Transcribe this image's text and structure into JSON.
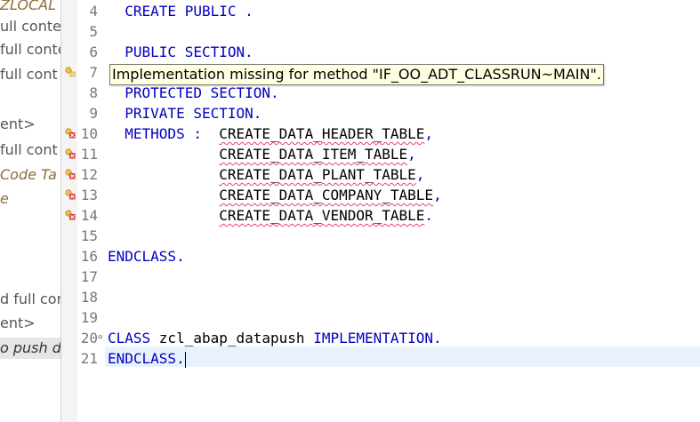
{
  "outline": {
    "items": [
      {
        "text": "ZLOCAL",
        "style": "italic"
      },
      {
        "text": "ull conten",
        "style": "normal"
      },
      {
        "text": "full conte",
        "style": "normal"
      },
      {
        "text": "full cont",
        "style": "normal"
      },
      {
        "text": "ent>",
        "style": "normal"
      },
      {
        "text": "full cont",
        "style": "normal"
      },
      {
        "text": "Code Ta",
        "style": "italic"
      },
      {
        "text": "e",
        "style": "italic"
      },
      {
        "text": "d full con",
        "style": "normal"
      },
      {
        "text": "ent>",
        "style": "normal"
      },
      {
        "text": "o push d",
        "style": "selected"
      }
    ]
  },
  "editor": {
    "lines": [
      {
        "num": "4",
        "tokens": [
          {
            "t": "  CREATE PUBLIC .",
            "c": "kw"
          }
        ]
      },
      {
        "num": "5",
        "tokens": []
      },
      {
        "num": "6",
        "tokens": [
          {
            "t": "  PUBLIC SECTION.",
            "c": "kw"
          }
        ]
      },
      {
        "num": "7",
        "tokens": [],
        "marker": "warning"
      },
      {
        "num": "8",
        "tokens": [
          {
            "t": "  PROTECTED SECTION.",
            "c": "kw"
          }
        ]
      },
      {
        "num": "9",
        "tokens": [
          {
            "t": "  PRIVATE SECTION.",
            "c": "kw"
          }
        ]
      },
      {
        "num": "10",
        "marker": "error",
        "tokens": [
          {
            "t": "  METHODS :  ",
            "c": "kw"
          },
          {
            "t": "CREATE_DATA_HEADER_TABLE",
            "c": "err"
          },
          {
            "t": ",",
            "c": "kw"
          }
        ]
      },
      {
        "num": "11",
        "marker": "error",
        "tokens": [
          {
            "t": "             ",
            "c": "id"
          },
          {
            "t": "CREATE_DATA_ITEM_TABLE",
            "c": "err"
          },
          {
            "t": ",",
            "c": "kw"
          }
        ]
      },
      {
        "num": "12",
        "marker": "error",
        "tokens": [
          {
            "t": "             ",
            "c": "id"
          },
          {
            "t": "CREATE_DATA_PLANT_TABLE",
            "c": "err"
          },
          {
            "t": ",",
            "c": "kw"
          }
        ]
      },
      {
        "num": "13",
        "marker": "error",
        "tokens": [
          {
            "t": "             ",
            "c": "id"
          },
          {
            "t": "CREATE_DATA_COMPANY_TABLE",
            "c": "err"
          },
          {
            "t": ",",
            "c": "kw"
          }
        ]
      },
      {
        "num": "14",
        "marker": "error",
        "tokens": [
          {
            "t": "             ",
            "c": "id"
          },
          {
            "t": "CREATE_DATA_VENDOR_TABLE",
            "c": "err"
          },
          {
            "t": ".",
            "c": "kw"
          }
        ]
      },
      {
        "num": "15",
        "tokens": []
      },
      {
        "num": "16",
        "tokens": [
          {
            "t": "ENDCLASS.",
            "c": "kw"
          }
        ]
      },
      {
        "num": "17",
        "tokens": []
      },
      {
        "num": "18",
        "tokens": []
      },
      {
        "num": "19",
        "tokens": []
      },
      {
        "num": "20",
        "fold": "⊖",
        "tokens": [
          {
            "t": "CLASS ",
            "c": "kw"
          },
          {
            "t": "zcl_abap_datapush",
            "c": "id"
          },
          {
            "t": " IMPLEMENTATION.",
            "c": "kw"
          }
        ]
      },
      {
        "num": "21",
        "current": true,
        "tokens": [
          {
            "t": "ENDCLASS.",
            "c": "kw"
          }
        ]
      }
    ]
  },
  "tooltip": {
    "text": "Implementation missing for method \"IF_OO_ADT_CLASSRUN~MAIN\"."
  },
  "colors": {
    "keyword": "#0000c0",
    "error_underline": "#e84070",
    "current_line": "#e8f2fe",
    "tooltip_bg": "#ffffe1"
  }
}
